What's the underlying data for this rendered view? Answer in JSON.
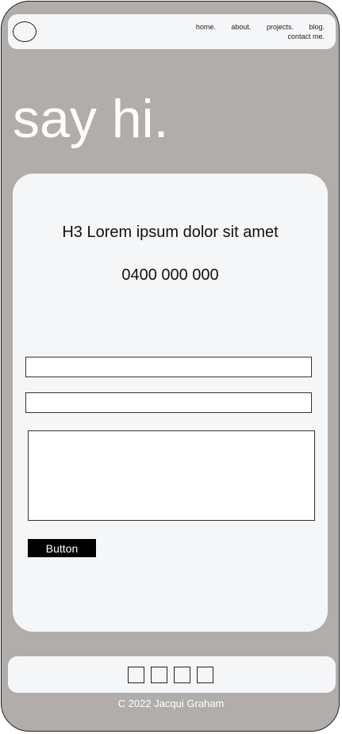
{
  "nav": {
    "items": [
      {
        "label": "home."
      },
      {
        "label": "about."
      },
      {
        "label": "projects."
      },
      {
        "label": "blog."
      },
      {
        "label": "contact me."
      }
    ]
  },
  "hero": {
    "title": "say hi."
  },
  "contact_card": {
    "heading": "H3 Lorem ipsum dolor sit amet",
    "phone": "0400 000 000",
    "button_label": "Button"
  },
  "footer": {
    "social_icons": [
      "social-icon-1",
      "social-icon-2",
      "social-icon-3",
      "social-icon-4"
    ],
    "copyright": "C 2022 Jacqui Graham"
  },
  "colors": {
    "background": "#b0adab",
    "surface": "#f5f6f8",
    "button": "#000000",
    "text_light": "#ffffff"
  }
}
